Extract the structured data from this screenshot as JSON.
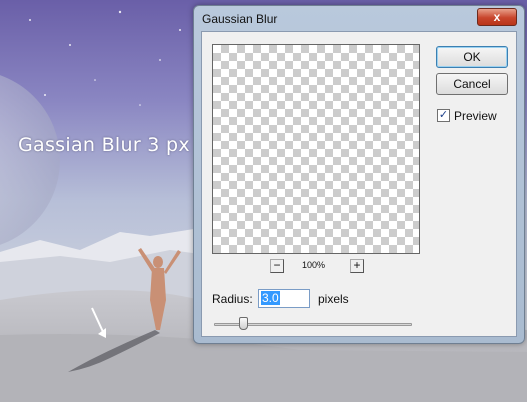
{
  "background": {
    "caption": "Gassian Blur 3 px"
  },
  "dialog": {
    "title": "Gaussian Blur",
    "close_glyph": "x",
    "ok_label": "OK",
    "cancel_label": "Cancel",
    "preview_label": "Preview",
    "preview_checked": true,
    "check_glyph": "✓",
    "zoom_out_glyph": "−",
    "zoom_in_glyph": "+",
    "zoom_level": "100%",
    "radius_label": "Radius:",
    "radius_value": "3.0",
    "radius_unit": "pixels",
    "slider_fraction": 0.13
  }
}
